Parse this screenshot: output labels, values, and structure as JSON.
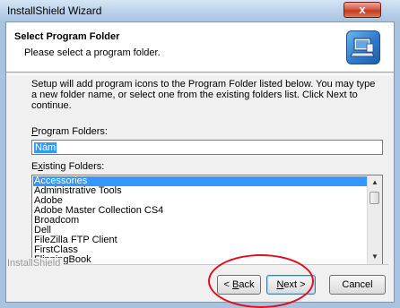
{
  "window": {
    "title": "InstallShield Wizard",
    "close_glyph": "x"
  },
  "header": {
    "title": "Select Program Folder",
    "subtitle": "Please select a program folder.",
    "icon": "setup-computer-icon"
  },
  "description": "Setup will add program icons to the Program Folder listed below.  You may type a new folder name, or select one from the existing folders list.  Click Next to continue.",
  "program_folders": {
    "label_first": "P",
    "label_rest": "rogram Folders:",
    "value": "Nám"
  },
  "existing_folders": {
    "label_first": "E",
    "label_mid": "x",
    "label_rest": "isting Folders:",
    "items": [
      "Accessories",
      "Administrative Tools",
      "Adobe",
      "Adobe Master Collection CS4",
      "Broadcom",
      "Dell",
      "FileZilla FTP Client",
      "FirstClass",
      "FlippingBook"
    ],
    "selected_index": 0
  },
  "branding": "InstallShield",
  "buttons": {
    "back_prefix": "< ",
    "back_key": "B",
    "back_rest": "ack",
    "next_key": "N",
    "next_rest": "ext >",
    "cancel": "Cancel"
  },
  "colors": {
    "accent": "#3399ff",
    "annotation": "#e01020"
  }
}
